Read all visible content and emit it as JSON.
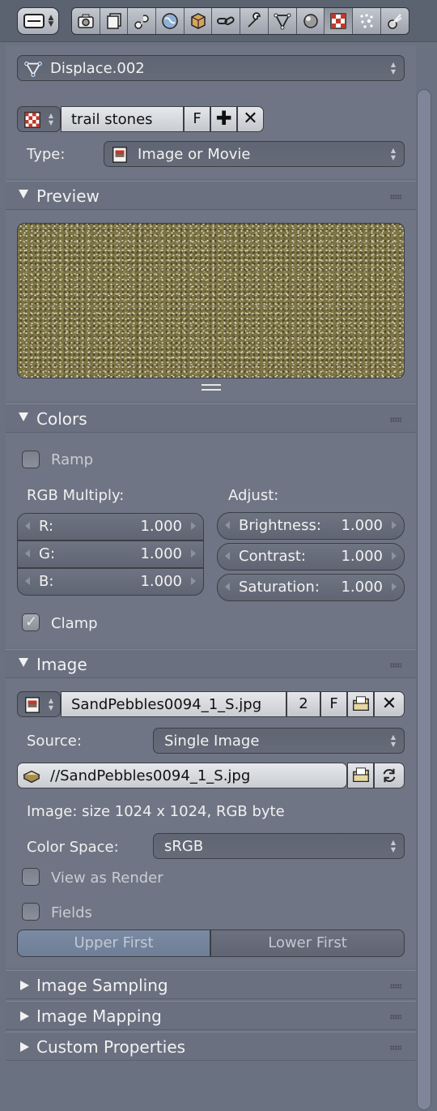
{
  "header": {
    "tabs": [
      "render-icon",
      "render-layers-icon",
      "scene-icon",
      "world-icon",
      "object-icon",
      "constraints-icon",
      "modifiers-icon",
      "data-icon",
      "material-icon",
      "texture-icon",
      "particles-icon",
      "physics-icon"
    ],
    "active_tab": "texture-icon"
  },
  "modifier": {
    "name": "Displace.002"
  },
  "texture": {
    "name": "trail stones",
    "fake_user": "F",
    "add_icon": "plus-icon",
    "remove_icon": "x-icon",
    "type_label": "Type:",
    "type_value": "Image or Movie"
  },
  "preview": {
    "title": "Preview"
  },
  "colors": {
    "title": "Colors",
    "ramp_label": "Ramp",
    "ramp_checked": false,
    "rgb_title": "RGB Multiply:",
    "adjust_title": "Adjust:",
    "r_label": "R:",
    "r_value": "1.000",
    "g_label": "G:",
    "g_value": "1.000",
    "b_label": "B:",
    "b_value": "1.000",
    "brightness_label": "Brightness:",
    "brightness_value": "1.000",
    "contrast_label": "Contrast:",
    "contrast_value": "1.000",
    "saturation_label": "Saturation:",
    "saturation_value": "1.000",
    "clamp_label": "Clamp",
    "clamp_checked": true
  },
  "image": {
    "title": "Image",
    "name": "SandPebbles0094_1_S.jpg",
    "users": "2",
    "fake_user": "F",
    "source_label": "Source:",
    "source_value": "Single Image",
    "filepath": "//SandPebbles0094_1_S.jpg",
    "info": "Image: size 1024 x 1024, RGB byte",
    "color_space_label": "Color Space:",
    "color_space_value": "sRGB",
    "view_as_render_label": "View as Render",
    "fields_label": "Fields",
    "upper_first": "Upper First",
    "lower_first": "Lower First"
  },
  "collapsed_panels": {
    "sampling": "Image Sampling",
    "mapping": "Image Mapping",
    "custom": "Custom Properties"
  },
  "colors_palette": {
    "background": "#6a7180",
    "panel": "#6f7584",
    "field_dark": "#5f6572",
    "field_light": "#d8dadd",
    "segment_active": "#7486a0"
  }
}
